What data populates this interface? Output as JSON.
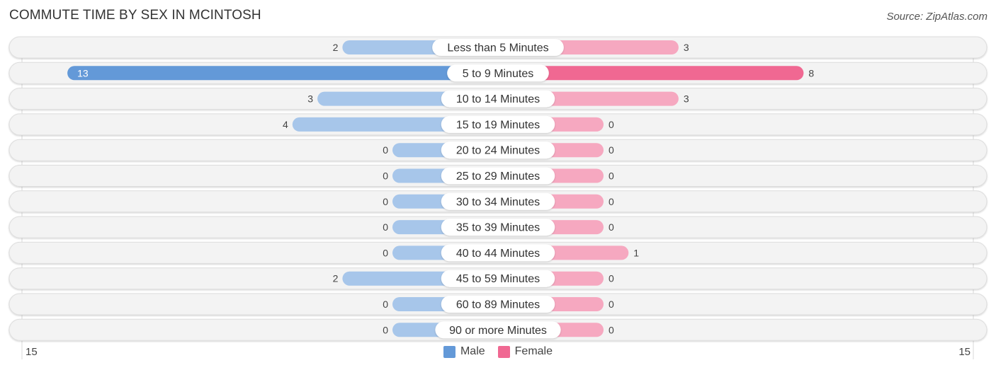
{
  "title": "COMMUTE TIME BY SEX IN MCINTOSH",
  "source": "Source: ZipAtlas.com",
  "colors": {
    "male_strong": "#6399d8",
    "male_light": "#a7c6ea",
    "female_strong": "#f06892",
    "female_light": "#f6a8c0",
    "row_bg": "#f3f3f3",
    "row_border": "#dddddd"
  },
  "chart_data": {
    "type": "bar",
    "orientation": "horizontal-diverging",
    "title": "COMMUTE TIME BY SEX IN MCINTOSH",
    "categories": [
      "Less than 5 Minutes",
      "5 to 9 Minutes",
      "10 to 14 Minutes",
      "15 to 19 Minutes",
      "20 to 24 Minutes",
      "25 to 29 Minutes",
      "30 to 34 Minutes",
      "35 to 39 Minutes",
      "40 to 44 Minutes",
      "45 to 59 Minutes",
      "60 to 89 Minutes",
      "90 or more Minutes"
    ],
    "series": [
      {
        "name": "Male",
        "values": [
          2,
          13,
          3,
          4,
          0,
          0,
          0,
          0,
          0,
          2,
          0,
          0
        ]
      },
      {
        "name": "Female",
        "values": [
          3,
          8,
          3,
          0,
          0,
          0,
          0,
          0,
          1,
          0,
          0,
          0
        ]
      }
    ],
    "xlim": [
      -15,
      15
    ],
    "axis_tick_labels": {
      "left": "15",
      "right": "15"
    },
    "legend": {
      "position": "bottom-center",
      "entries": [
        "Male",
        "Female"
      ]
    }
  }
}
